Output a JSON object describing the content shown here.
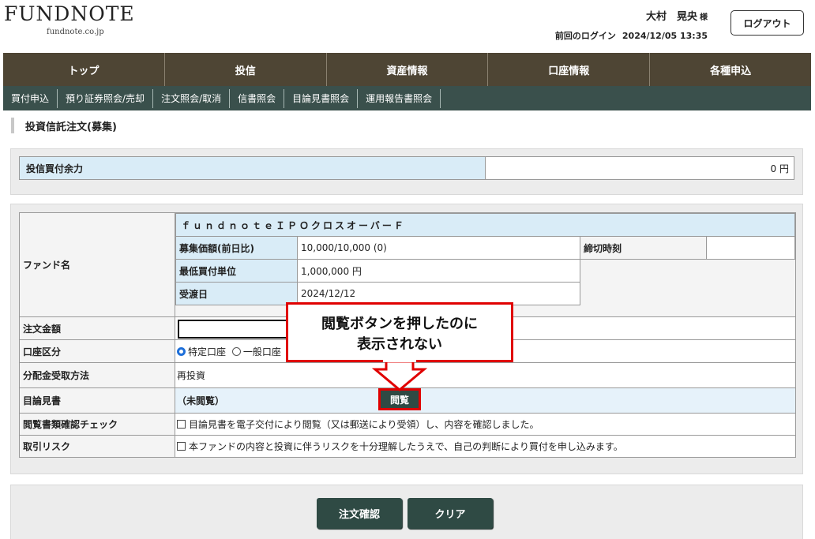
{
  "logo": {
    "main": "FUNDNOTE",
    "sub": "fundnote.co.jp"
  },
  "user": {
    "name": "大村　晃央",
    "honorific": "様",
    "last_login_label": "前回のログイン",
    "last_login_time": "2024/12/05 13:35"
  },
  "logout_label": "ログアウト",
  "main_nav": [
    "トップ",
    "投信",
    "資産情報",
    "口座情報",
    "各種申込"
  ],
  "sub_nav": [
    "買付申込",
    "預り証券照会/売却",
    "注文照会/取消",
    "信書照会",
    "目論見書照会",
    "運用報告書照会"
  ],
  "page_title": "投資信託注文(募集)",
  "available": {
    "label": "投信買付余力",
    "value": "0 円"
  },
  "order": {
    "fund_label": "ファンド名",
    "fund_name": "ｆｕｎｄｎｏｔｅＩＰＯクロスオーバーＦ",
    "price_label": "募集価額(前日比)",
    "price_value": "10,000/10,000 (0)",
    "deadline_label": "締切時刻",
    "deadline_value": "",
    "min_unit_label": "最低買付単位",
    "min_unit_value": "1,000,000 円",
    "delivery_label": "受渡日",
    "delivery_value": "2024/12/12",
    "amount_label": "注文金額",
    "amount_value": "",
    "account_label": "口座区分",
    "account_options": [
      "特定口座",
      "一般口座"
    ],
    "dividend_label": "分配金受取方法",
    "dividend_value": "再投資",
    "prospectus_label": "目論見書",
    "prospectus_status": "（未閲覧）",
    "view_button": "閲覧",
    "doc_check_label": "閲覧書類確認チェック",
    "doc_check_text": "目論見書を電子交付により閲覧（又は郵送により受領）し、内容を確認しました。",
    "risk_label": "取引リスク",
    "risk_text": "本ファンドの内容と投資に伴うリスクを十分理解したうえで、自己の判断により買付を申し込みます。"
  },
  "callout": {
    "line1": "閲覧ボタンを押したのに",
    "line2": "表示されない"
  },
  "buttons": {
    "confirm": "注文確認",
    "clear": "クリア"
  },
  "colors": {
    "main_nav": "#4e4534",
    "sub_nav": "#3a504c",
    "button": "#2f4a44",
    "highlight": "#e00000",
    "label_bg": "#d9ecf7"
  }
}
